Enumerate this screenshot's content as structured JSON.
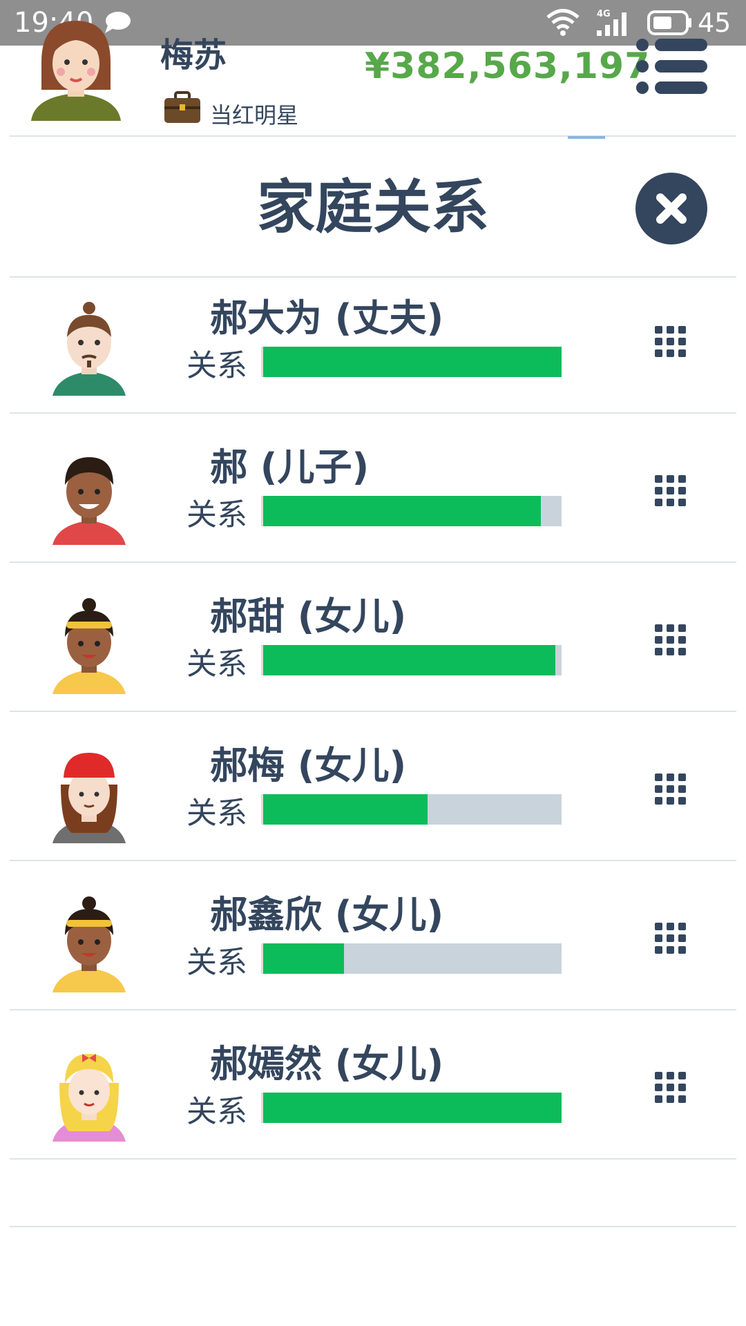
{
  "status_bar": {
    "time": "19:40",
    "battery": "45",
    "network": "4G"
  },
  "profile": {
    "name": "梅苏",
    "job": "当红明星",
    "money": "¥382,563,197"
  },
  "dialog": {
    "title": "家庭关系"
  },
  "relation_label": "关系",
  "family": [
    {
      "name": "郝大为 (丈夫)",
      "relationship_pct": 100
    },
    {
      "name": "郝 (儿子)",
      "relationship_pct": 93
    },
    {
      "name": "郝甜 (女儿)",
      "relationship_pct": 98
    },
    {
      "name": "郝梅 (女儿)",
      "relationship_pct": 55
    },
    {
      "name": "郝鑫欣 (女儿)",
      "relationship_pct": 27
    },
    {
      "name": "郝嫣然 (女儿)",
      "relationship_pct": 100
    }
  ],
  "colors": {
    "accent_green": "#0cbc5a",
    "money_green": "#57a84a",
    "navy": "#34465e",
    "track_gray": "#c9d3dc"
  }
}
